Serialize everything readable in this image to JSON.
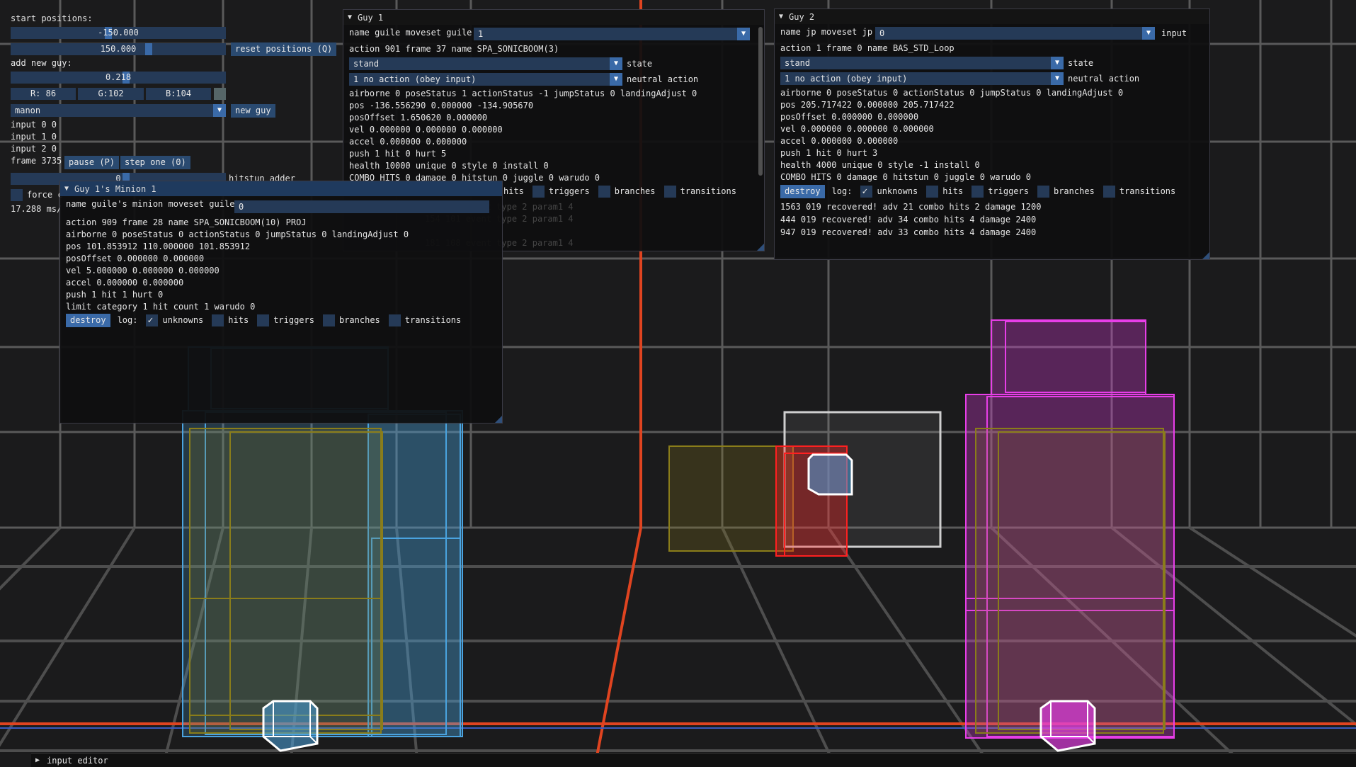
{
  "colors": {
    "blue_guy": "#4aa3df",
    "magenta_guy": "#e83ee8",
    "olive": "#8a7d1a",
    "red_box": "#ff2020",
    "white_box": "#cfcfcf",
    "axis_red": "#e04420",
    "grid": "#5a5a5a",
    "panel_field": "#253a57",
    "button": "#2a4a70"
  },
  "main": {
    "start_positions_label": "start positions:",
    "pos1": "-150.000",
    "pos2": "150.000",
    "reset_label": "reset positions (Q)",
    "add_guy_label": "add new guy:",
    "hue_value": "0.218",
    "r": "R: 86",
    "g": "G:102",
    "b": "B:104",
    "char_select": "manon",
    "new_guy_label": "new guy",
    "input0": "input 0 0",
    "input1": "input 1 0",
    "input2": "input 2 0",
    "frame": "frame 3735",
    "pause_label": "pause (P)",
    "step_label": "step one (0)",
    "hitstun_value": "0",
    "hitstun_label": "hitstun adder",
    "force_label": "force c",
    "ms_label": "17.288 ms/"
  },
  "guy1": {
    "title": "Guy 1",
    "name_line": "name guile moveset guile",
    "moveset_value": "1",
    "action_line": "action 901 frame 37 name SPA_SONICBOOM(3)",
    "state_value": "stand",
    "state_label": "state",
    "neutral_value": "1 no action (obey input)",
    "neutral_label": "neutral action",
    "airborne": "airborne 0 poseStatus 1 actionStatus -1 jumpStatus 0 landingAdjust 0",
    "pos": "pos -136.556290 0.000000 -134.905670",
    "posOffset": "posOffset 1.650620 0.000000",
    "vel": "vel 0.000000 0.000000 0.000000",
    "accel": "accel 0.000000 0.000000",
    "push": "push 1 hit 0 hurt 5",
    "health": "health 10000 unique 0 style 0 install 0",
    "combo": "COMBO HITS 0 damage 0 hitstun 0 juggle 0 warudo 0",
    "log_hits": "hits",
    "log_triggers": "triggers",
    "log_branches": "branches",
    "log_transitions": "transitions",
    "ghost1": "164 101 event type 2 param1 4",
    "ghost2": "154 101 event type 2 param1 4",
    "ghost3": "181 108 event type 2 param1 4"
  },
  "guy2": {
    "title": "Guy 2",
    "name_line": "name jp moveset jp",
    "moveset_value": "0",
    "input_label": "input",
    "action_line": "action 1 frame 0 name BAS_STD_Loop",
    "state_value": "stand",
    "state_label": "state",
    "neutral_value": "1 no action (obey input)",
    "neutral_label": "neutral action",
    "airborne": "airborne 0 poseStatus 0 actionStatus 0 jumpStatus 0 landingAdjust 0",
    "pos": "pos 205.717422 0.000000 205.717422",
    "posOffset": "posOffset 0.000000 0.000000",
    "vel": "vel 0.000000 0.000000 0.000000",
    "accel": "accel 0.000000 0.000000",
    "push": "push 1 hit 0 hurt 3",
    "health": "health 4000 unique 0 style -1 install 0",
    "combo": "COMBO HITS 0 damage 0 hitstun 0 juggle 0 warudo 0",
    "destroy_label": "destroy",
    "log_label": "log:",
    "log_unknowns": "unknowns",
    "log_hits": "hits",
    "log_triggers": "triggers",
    "log_branches": "branches",
    "log_transitions": "transitions",
    "log_lines": [
      "1563 019 recovered! adv 21 combo hits 2 damage 1200",
      "444 019 recovered! adv 34 combo hits 4 damage 2400",
      "947 019 recovered! adv 33 combo hits 4 damage 2400"
    ]
  },
  "minion": {
    "title": "Guy 1's Minion 1",
    "name_line": "name guile's minion moveset guile",
    "moveset_value": "0",
    "action_line": "action 909 frame 28 name SPA_SONICBOOM(10) PROJ",
    "airborne": "airborne 0 poseStatus 0 actionStatus 0 jumpStatus 0 landingAdjust 0",
    "pos": "pos 101.853912 110.000000 101.853912",
    "posOffset": "posOffset 0.000000 0.000000",
    "vel": "vel 5.000000 0.000000 0.000000",
    "accel": "accel 0.000000 0.000000",
    "push": "push 1 hit 1 hurt 0",
    "limit": "limit category 1 hit count 1 warudo 0",
    "destroy_label": "destroy",
    "log_label": "log:",
    "log_unknowns": "unknowns",
    "log_hits": "hits",
    "log_triggers": "triggers",
    "log_branches": "branches",
    "log_transitions": "transitions"
  },
  "input_editor": {
    "label": "input editor"
  }
}
